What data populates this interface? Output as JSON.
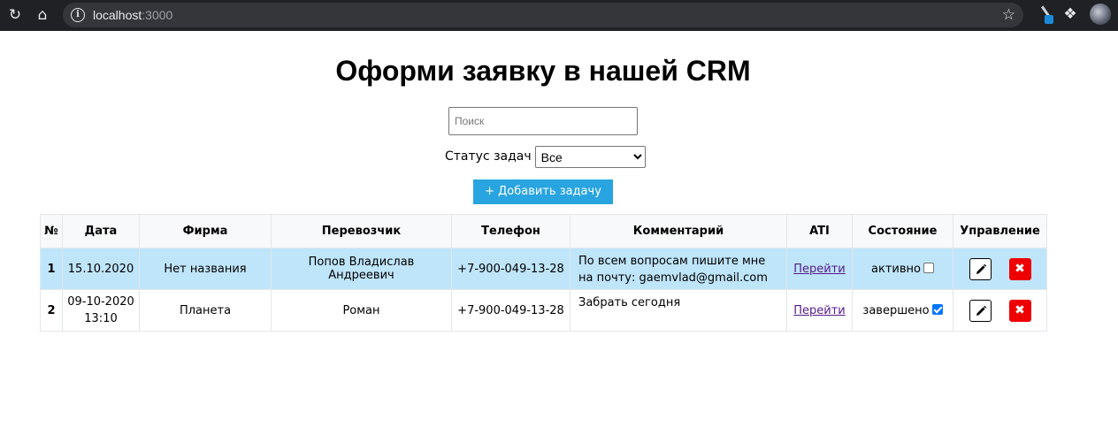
{
  "browser": {
    "url_host": "localhost",
    "url_port": ":3000",
    "icons": [
      "reload-icon",
      "home-icon",
      "info-icon",
      "star-icon",
      "extension-icon",
      "puzzle-icon",
      "avatar"
    ]
  },
  "page": {
    "title": "Оформи заявку в нашей CRM",
    "search_placeholder": "Поиск",
    "status_label": "Статус задач",
    "status_selected": "Все",
    "add_button": "+ Добавить задачу"
  },
  "table": {
    "headers": [
      "№",
      "Дата",
      "Фирма",
      "Перевозчик",
      "Телефон",
      "Комментарий",
      "ATI",
      "Состояние",
      "Управление"
    ],
    "rows": [
      {
        "num": "1",
        "date": "15.10.2020",
        "firm": "Нет названия",
        "carrier": "Попов Владислав Андреевич",
        "phone": "+7-900-049-13-28",
        "comment": "По всем вопросам пишите мне на почту: gaemvlad@gmail.com",
        "ati": "Перейти",
        "state": "активно",
        "checked": false,
        "highlighted": true
      },
      {
        "num": "2",
        "date": "09-10-2020 13:10",
        "firm": "Планета",
        "carrier": "Роман",
        "phone": "+7-900-049-13-28",
        "comment": "Забрать сегодня",
        "ati": "Перейти",
        "state": "завершено",
        "checked": true,
        "highlighted": false
      }
    ]
  },
  "colors": {
    "accent_button": "#28a4e0",
    "row_highlight": "#bfe5fa",
    "delete_button": "#ee0000",
    "link": "#551a8b"
  }
}
